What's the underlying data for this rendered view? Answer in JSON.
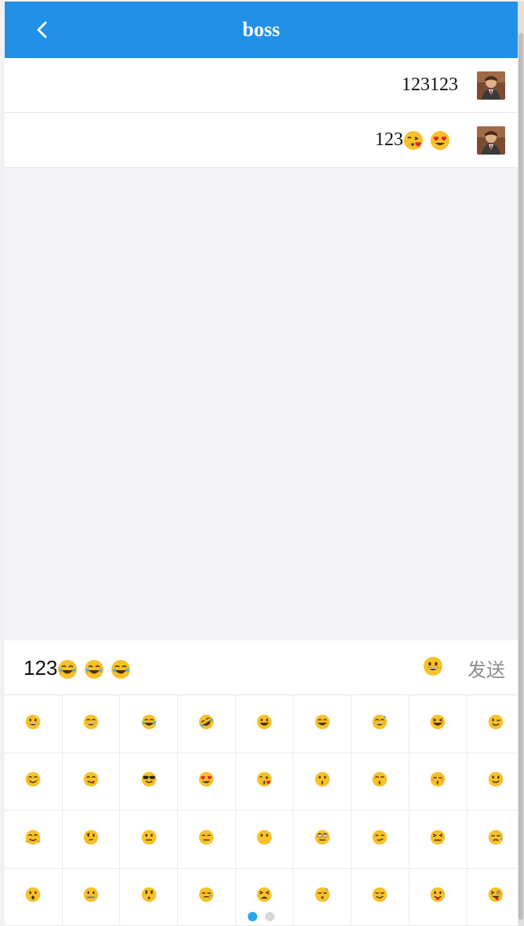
{
  "header": {
    "title": "boss",
    "back_icon": "chevron-left-icon"
  },
  "messages": [
    {
      "text": "123123",
      "emojis": []
    },
    {
      "text": "123",
      "emojis": [
        "kissing-heart-emoji",
        "heart-eyes-emoji"
      ]
    }
  ],
  "input": {
    "value": "123",
    "emojis": [
      "joy-emoji",
      "joy-emoji",
      "joy-emoji"
    ]
  },
  "toolbar": {
    "emoji_button_icon": "grinning-emoji",
    "send_label": "发送"
  },
  "emoji_panel": {
    "rows": [
      [
        "grinning",
        "grin",
        "joy",
        "rofl",
        "smiley",
        "smile",
        "sweat-smile",
        "laughing",
        "wink"
      ],
      [
        "blush",
        "yum",
        "sunglasses",
        "heart-eyes",
        "kissing-heart",
        "kissing",
        "kissing-smiling-eyes",
        "kissing-closed-eyes",
        "slightly-smiling"
      ],
      [
        "hugging",
        "thinking",
        "neutral",
        "expressionless",
        "no-mouth",
        "rolling-eyes",
        "smirk",
        "persevere",
        "disappointed-relieved"
      ],
      [
        "open-mouth",
        "zipper-mouth",
        "hushed",
        "sleepy",
        "tired",
        "sleeping",
        "relieved",
        "tongue",
        "stuck-out-tongue-winking"
      ]
    ],
    "pages": 2,
    "active_page": 1
  },
  "colors": {
    "header_bg": "#2190e6",
    "send_text": "#8c8c8c",
    "active_dot": "#2aa6ea",
    "inactive_dot": "#d8d8d8",
    "chat_bg": "#f3f3f8"
  }
}
